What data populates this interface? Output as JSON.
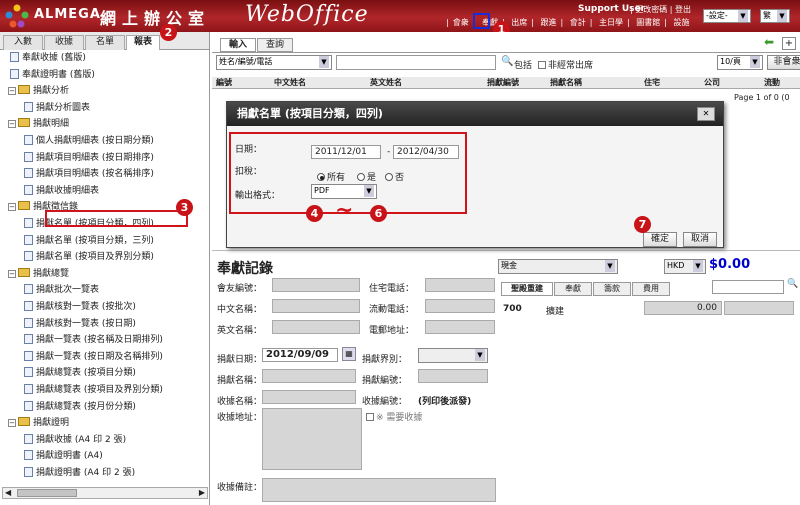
{
  "header": {
    "brand": "ALMEGA",
    "cjk_title": "網上辦公室",
    "product": "WebOffice",
    "user": "Support User",
    "top_links": "| 更改密碼 | 登出",
    "nav_links": [
      "會衆",
      "奉獻",
      "出席",
      "跟進",
      "會計",
      "主日學",
      "圖書館",
      "設施"
    ],
    "settings_select": "-設定-",
    "lang_select": "繁"
  },
  "left_tabs": [
    "入數",
    "收據",
    "名單",
    "報表"
  ],
  "tree": {
    "items": [
      {
        "label": "奉獻收據 (舊版)",
        "type": "doc"
      },
      {
        "label": "奉獻證明書 (舊版)",
        "type": "doc"
      },
      {
        "label": "捐獻分析",
        "type": "folder"
      },
      {
        "label": "捐獻分析圖表",
        "type": "doc"
      },
      {
        "label": "捐獻明細",
        "type": "folder"
      },
      {
        "label": "個人捐獻明細表 (按日期分類)",
        "type": "doc"
      },
      {
        "label": "捐獻項目明細表 (按日期排序)",
        "type": "doc"
      },
      {
        "label": "捐獻項目明細表 (按名稱排序)",
        "type": "doc"
      },
      {
        "label": "捐獻收據明細表",
        "type": "doc"
      },
      {
        "label": "捐獻徵信錄",
        "type": "folder"
      },
      {
        "label": "捐獻名單 (按項目分類，四列)",
        "type": "doc"
      },
      {
        "label": "捐獻名單 (按項目分類，三列)",
        "type": "doc"
      },
      {
        "label": "捐獻名單 (按項目及界別分類)",
        "type": "doc"
      },
      {
        "label": "捐獻總覽",
        "type": "folder"
      },
      {
        "label": "捐獻批次一覽表",
        "type": "doc"
      },
      {
        "label": "捐獻核對一覽表 (按批次)",
        "type": "doc"
      },
      {
        "label": "捐獻核對一覽表 (按日期)",
        "type": "doc"
      },
      {
        "label": "捐獻一覽表 (按名稱及日期排列)",
        "type": "doc"
      },
      {
        "label": "捐獻一覽表 (按日期及名稱排列)",
        "type": "doc"
      },
      {
        "label": "捐獻總覽表 (按項目分類)",
        "type": "doc"
      },
      {
        "label": "捐獻總覽表 (按項目及界別分類)",
        "type": "doc"
      },
      {
        "label": "捐獻總覽表 (按月份分類)",
        "type": "doc"
      },
      {
        "label": "捐獻證明",
        "type": "folder"
      },
      {
        "label": "捐獻收據 (A4 印 2 張)",
        "type": "doc"
      },
      {
        "label": "捐獻證明書 (A4)",
        "type": "doc"
      },
      {
        "label": "捐獻證明書 (A4 印 2 張)",
        "type": "doc"
      }
    ]
  },
  "right_tabs": [
    "輸入",
    "查詢"
  ],
  "search": {
    "field_select": "姓名/編號/電話",
    "include_label": "包括",
    "non_regular_label": "非經常出席",
    "page_size": "10/頁",
    "non_member_btn": "非會衆"
  },
  "table_headers": [
    "編號",
    "中文姓名",
    "英文姓名",
    "捐獻編號",
    "捐獻名稱",
    "住宅",
    "公司",
    "流動"
  ],
  "pager": "Page 1 of 0 (0",
  "modal": {
    "title": "捐獻名單 (按項目分類，四列)",
    "date_label": "日期：",
    "date_from": "2011/12/01",
    "date_sep": "-",
    "date_to": "2012/04/30",
    "tax_label": "扣稅：",
    "tax_options": [
      "所有",
      "是",
      "否"
    ],
    "format_label": "輸出格式：",
    "format_value": "PDF",
    "confirm": "確定",
    "cancel": "取消"
  },
  "record": {
    "title": "奉獻記錄",
    "currency": "現金",
    "hkd": "HKD",
    "amount": "$0.00",
    "fields": {
      "member_no": "會友編號：",
      "cn_name": "中文名稱：",
      "en_name": "英文名稱：",
      "home_phone": "住宅電話：",
      "mobile": "流動電話：",
      "email": "電郵地址：",
      "date_label": "捐獻日期：",
      "date_value": "2012/09/09",
      "category": "捐獻界別：",
      "item_name": "捐獻名稱：",
      "item_no": "捐獻編號：",
      "receipt_name": "收據名稱：",
      "receipt_no": "收據編號：",
      "receipt_no_value": "(列印後派發)",
      "receipt_addr": "收據地址：",
      "need_receipt": "※ 需要收據",
      "remarks": "收據備註："
    },
    "tabs": [
      "聖殿重建",
      "奉獻",
      "籌款",
      "費用"
    ],
    "row_code": "700",
    "row_name": "擴建",
    "row_amount": "0.00"
  },
  "annotations": {
    "c1": "1",
    "c2": "2",
    "c3": "3",
    "c4": "4",
    "c6": "6",
    "c7": "7",
    "tilde": "~"
  },
  "colors": {
    "header_red": "#b0262a",
    "annot_red": "#d0141a",
    "annot_blue": "#1a2bd8",
    "amount_blue": "#0000cc"
  }
}
